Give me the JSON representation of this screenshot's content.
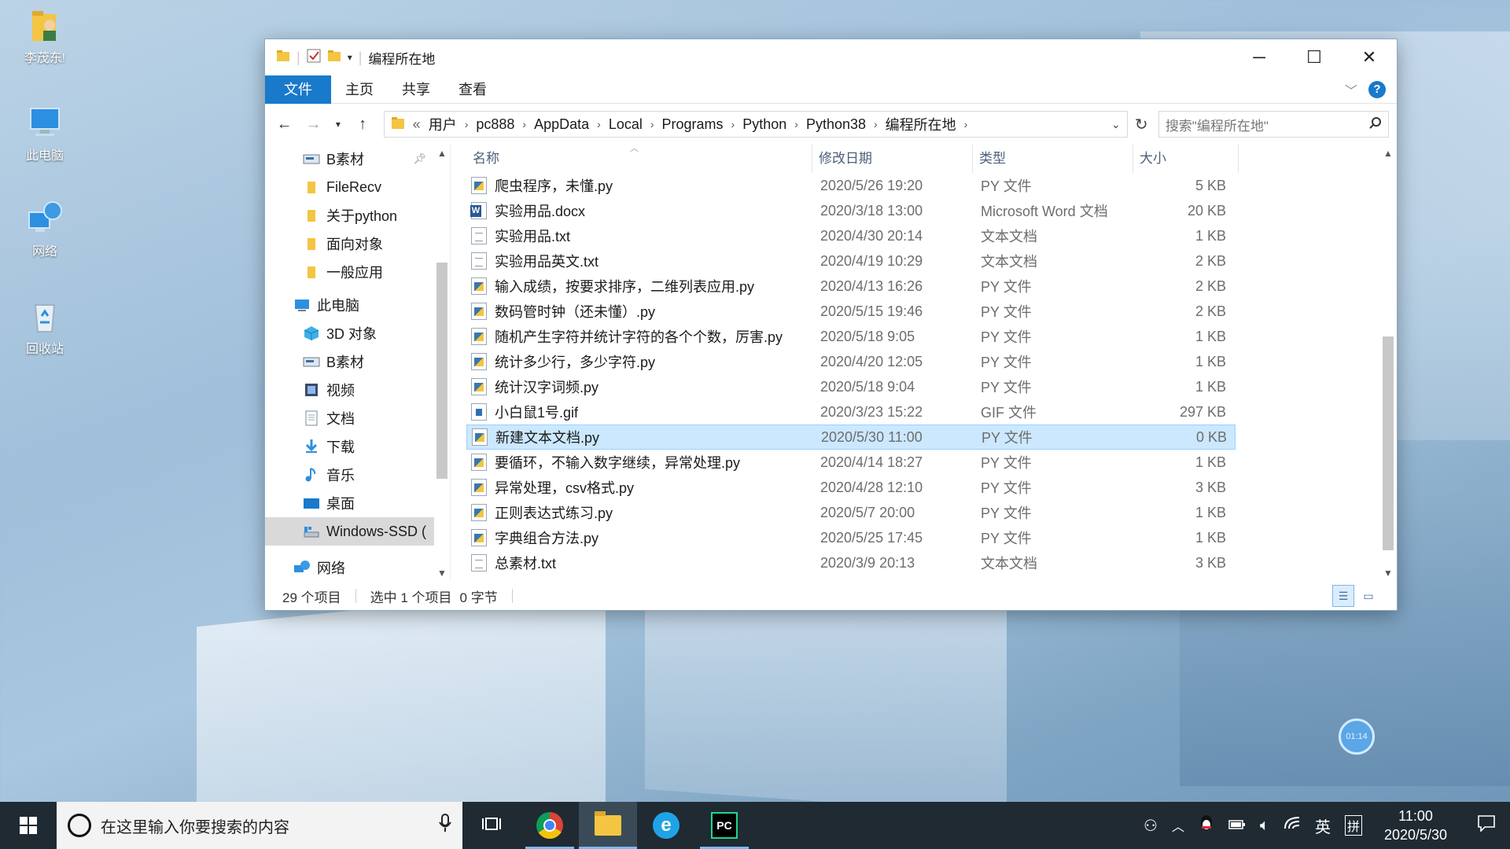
{
  "desktop": {
    "icons": [
      {
        "label": "李茂东!",
        "icon": "user-folder-icon"
      },
      {
        "label": "此电脑",
        "icon": "computer-icon"
      },
      {
        "label": "网络",
        "icon": "network-icon"
      },
      {
        "label": "回收站",
        "icon": "recycle-bin-icon"
      }
    ],
    "timer": "01:14"
  },
  "window": {
    "title": "编程所在地",
    "controls": {
      "minimize": "─",
      "maximize": "☐",
      "close": "✕"
    }
  },
  "ribbon": {
    "tabs": [
      "文件",
      "主页",
      "共享",
      "查看"
    ],
    "help": "?"
  },
  "address": {
    "prefix": "«",
    "crumbs": [
      "用户",
      "pc888",
      "AppData",
      "Local",
      "Programs",
      "Python",
      "Python38",
      "编程所在地"
    ],
    "search_placeholder": "搜索\"编程所在地\""
  },
  "nav_pane": {
    "items": [
      {
        "label": "B素材",
        "icon": "drive-icon",
        "indent": 1,
        "pinned": true
      },
      {
        "label": "FileRecv",
        "icon": "folder-icon",
        "indent": 1
      },
      {
        "label": "关于python",
        "icon": "folder-icon",
        "indent": 1
      },
      {
        "label": "面向对象",
        "icon": "folder-icon",
        "indent": 1
      },
      {
        "label": "一般应用",
        "icon": "folder-icon",
        "indent": 1
      },
      {
        "label": "此电脑",
        "icon": "computer-icon",
        "indent": 0
      },
      {
        "label": "3D 对象",
        "icon": "3d-objects-icon",
        "indent": 1
      },
      {
        "label": "B素材",
        "icon": "drive-icon",
        "indent": 1
      },
      {
        "label": "视频",
        "icon": "video-icon",
        "indent": 1
      },
      {
        "label": "文档",
        "icon": "document-icon",
        "indent": 1
      },
      {
        "label": "下载",
        "icon": "download-icon",
        "indent": 1
      },
      {
        "label": "音乐",
        "icon": "music-icon",
        "indent": 1
      },
      {
        "label": "桌面",
        "icon": "desktop-icon",
        "indent": 1
      },
      {
        "label": "Windows-SSD (",
        "icon": "ssd-drive-icon",
        "indent": 1,
        "selected": true
      },
      {
        "label": "网络",
        "icon": "network-icon",
        "indent": 0
      }
    ]
  },
  "columns": {
    "name": "名称",
    "date": "修改日期",
    "type": "类型",
    "size": "大小"
  },
  "files": [
    {
      "name": "爬虫程序，未懂.py",
      "date": "2020/5/26 19:20",
      "type": "PY 文件",
      "size": "5 KB",
      "kind": "py"
    },
    {
      "name": "实验用品.docx",
      "date": "2020/3/18 13:00",
      "type": "Microsoft Word 文档",
      "size": "20 KB",
      "kind": "docx"
    },
    {
      "name": "实验用品.txt",
      "date": "2020/4/30 20:14",
      "type": "文本文档",
      "size": "1 KB",
      "kind": "txt"
    },
    {
      "name": "实验用品英文.txt",
      "date": "2020/4/19 10:29",
      "type": "文本文档",
      "size": "2 KB",
      "kind": "txt"
    },
    {
      "name": "输入成绩，按要求排序，二维列表应用.py",
      "date": "2020/4/13 16:26",
      "type": "PY 文件",
      "size": "2 KB",
      "kind": "py"
    },
    {
      "name": "数码管时钟（还未懂）.py",
      "date": "2020/5/15 19:46",
      "type": "PY 文件",
      "size": "2 KB",
      "kind": "py"
    },
    {
      "name": "随机产生字符并统计字符的各个个数，厉害.py",
      "date": "2020/5/18 9:05",
      "type": "PY 文件",
      "size": "1 KB",
      "kind": "py"
    },
    {
      "name": "统计多少行，多少字符.py",
      "date": "2020/4/20 12:05",
      "type": "PY 文件",
      "size": "1 KB",
      "kind": "py"
    },
    {
      "name": "统计汉字词频.py",
      "date": "2020/5/18 9:04",
      "type": "PY 文件",
      "size": "1 KB",
      "kind": "py"
    },
    {
      "name": "小白鼠1号.gif",
      "date": "2020/3/23 15:22",
      "type": "GIF 文件",
      "size": "297 KB",
      "kind": "gif"
    },
    {
      "name": "新建文本文档.py",
      "date": "2020/5/30 11:00",
      "type": "PY 文件",
      "size": "0 KB",
      "kind": "py",
      "selected": true
    },
    {
      "name": "要循环，不输入数字继续，异常处理.py",
      "date": "2020/4/14 18:27",
      "type": "PY 文件",
      "size": "1 KB",
      "kind": "py"
    },
    {
      "name": "异常处理，csv格式.py",
      "date": "2020/4/28 12:10",
      "type": "PY 文件",
      "size": "3 KB",
      "kind": "py"
    },
    {
      "name": "正则表达式练习.py",
      "date": "2020/5/7 20:00",
      "type": "PY 文件",
      "size": "1 KB",
      "kind": "py"
    },
    {
      "name": "字典组合方法.py",
      "date": "2020/5/25 17:45",
      "type": "PY 文件",
      "size": "1 KB",
      "kind": "py"
    },
    {
      "name": "总素材.txt",
      "date": "2020/3/9 20:13",
      "type": "文本文档",
      "size": "3 KB",
      "kind": "txt"
    }
  ],
  "status": {
    "count": "29 个项目",
    "selection": "选中 1 个项目",
    "bytes": "0 字节"
  },
  "taskbar": {
    "search_placeholder": "在这里输入你要搜索的内容",
    "ime": "英",
    "ime_mode": "拼",
    "time": "11:00",
    "date": "2020/5/30"
  },
  "colors": {
    "accent": "#1979ca",
    "selection": "#cce8ff",
    "taskbar": "#1f2a33"
  }
}
